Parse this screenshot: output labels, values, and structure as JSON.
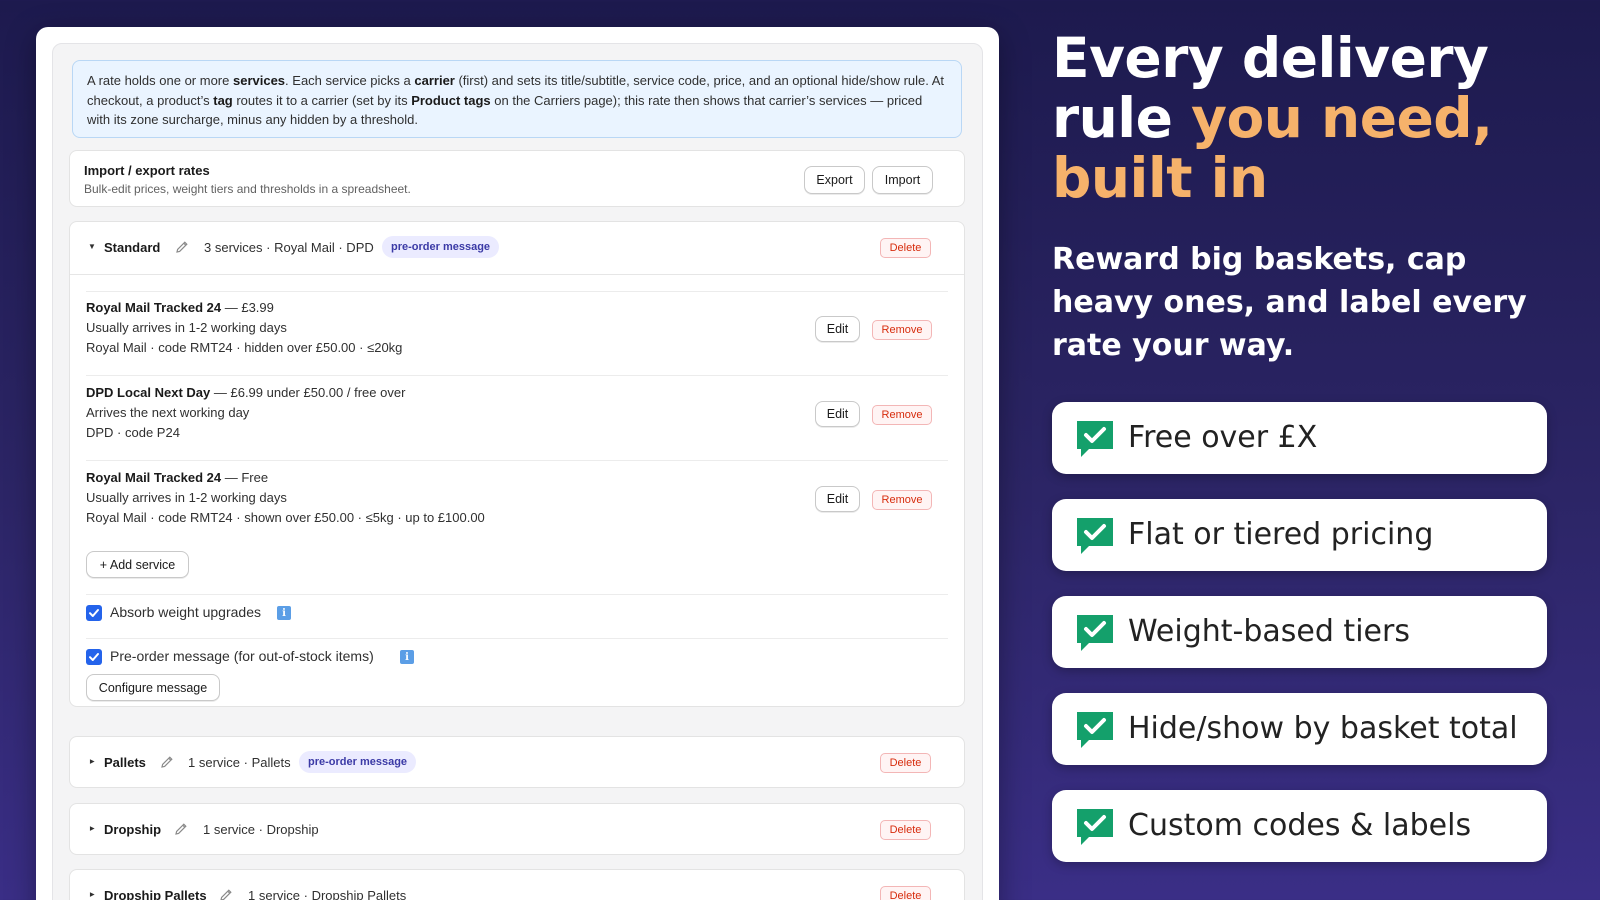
{
  "colors": {
    "background": "#231f5c",
    "accent": "#f6b26b",
    "check_green": "#14a06b",
    "primary_blue": "#2463eb",
    "danger": "#d72c0d",
    "pill": "#3b3aa6"
  },
  "info_banner": {
    "t1": "A rate holds one or more ",
    "t2": "services",
    "t3": ". Each service picks a ",
    "t4": "carrier",
    "t5": " (first) and sets its title/subtitle, service code, price, and an optional hide/show rule. At checkout, a product’s ",
    "t6": "tag",
    "t7": " routes it to a carrier (set by its ",
    "t8": "Product tags",
    "t9": " on the Carriers page); this rate then shows that carrier’s services — priced with its zone surcharge, minus any hidden by a threshold."
  },
  "import_export": {
    "title": "Import / export rates",
    "subtitle": "Bulk-edit prices, weight tiers and thresholds in a spreadsheet.",
    "export_label": "Export",
    "import_label": "Import"
  },
  "rates": [
    {
      "name": "Standard",
      "meta": "3 services · Royal Mail · DPD",
      "pill": "pre-order message",
      "delete_label": "Delete",
      "services": [
        {
          "title": "Royal Mail Tracked 24",
          "price": " — £3.99",
          "subtitle": "Usually arrives in 1-2 working days",
          "detail": "Royal Mail · code RMT24 · hidden over £50.00 · ≤20kg",
          "edit_label": "Edit",
          "remove_label": "Remove"
        },
        {
          "title": "DPD Local Next Day",
          "price": " — £6.99 under £50.00 / free over",
          "subtitle": "Arrives the next working day",
          "detail": "DPD · code P24",
          "edit_label": "Edit",
          "remove_label": "Remove"
        },
        {
          "title": "Royal Mail Tracked 24",
          "price": " — Free",
          "subtitle": "Usually arrives in 1-2 working days",
          "detail": "Royal Mail · code RMT24 · shown over £50.00 · ≤5kg · up to £100.00",
          "edit_label": "Edit",
          "remove_label": "Remove"
        }
      ],
      "add_service_label": "+ Add service",
      "absorb_label": "Absorb weight upgrades",
      "absorb_checked": true,
      "preorder_label": "Pre-order message (for out-of-stock items)",
      "preorder_checked": true,
      "configure_label": "Configure message"
    },
    {
      "name": "Pallets",
      "meta": "1 service · Pallets",
      "pill": "pre-order message",
      "delete_label": "Delete"
    },
    {
      "name": "Dropship",
      "meta": "1 service · Dropship",
      "delete_label": "Delete"
    },
    {
      "name": "Dropship Pallets",
      "meta": "1 service · Dropship Pallets",
      "delete_label": "Delete"
    }
  ],
  "marketing": {
    "headline_1": "Every delivery rule ",
    "headline_accent": "you need, built in",
    "subhead": "Reward big baskets, cap heavy ones, and label every rate your way.",
    "features": [
      "Free over £X",
      "Flat or tiered pricing",
      "Weight-based tiers",
      "Hide/show by basket total",
      "Custom codes & labels"
    ]
  }
}
